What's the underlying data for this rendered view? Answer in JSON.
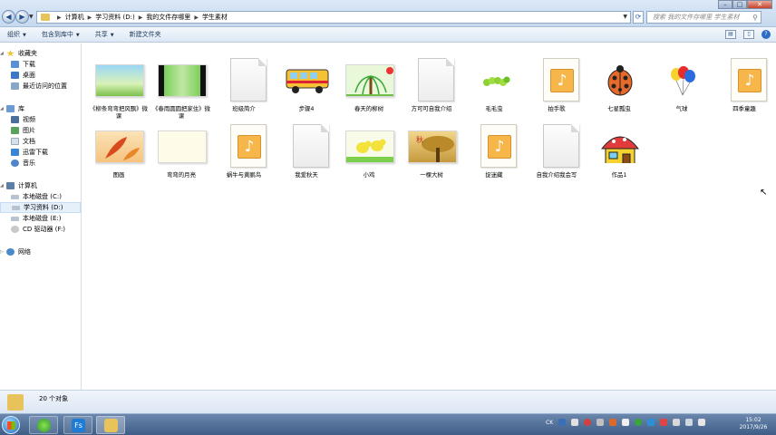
{
  "address": {
    "crumbs": [
      "计算机",
      "学习资料 (D:)",
      "我的文件存哪里",
      "学生素材"
    ],
    "search_placeholder": "搜索 我的文件存哪里 学生素材"
  },
  "toolbar": {
    "organize": "组织",
    "include": "包含到库中",
    "share": "共享",
    "new_folder": "新建文件夹"
  },
  "nav": {
    "favorites": "收藏夹",
    "downloads": "下载",
    "desktop": "桌面",
    "recent": "最近访问的位置",
    "libraries": "库",
    "videos": "视频",
    "pictures": "图片",
    "documents": "文档",
    "thunder": "迅雷下载",
    "music": "音乐",
    "computer": "计算机",
    "drive_c": "本地磁盘 (C:)",
    "drive_d": "学习资料 (D:)",
    "drive_e": "本地磁盘 (E:)",
    "drive_f": "CD 驱动器 (F:)",
    "network": "网络"
  },
  "files": [
    {
      "label": "《柳条弯弯把风飘》微课",
      "kind": "video-green"
    },
    {
      "label": "《春雨圆圆把家住》微课",
      "kind": "video-dark"
    },
    {
      "label": "班级简介",
      "kind": "doc"
    },
    {
      "label": "步骤4",
      "kind": "bus"
    },
    {
      "label": "春天的柳树",
      "kind": "willow"
    },
    {
      "label": "方可可自我介绍",
      "kind": "doc"
    },
    {
      "label": "毛毛虫",
      "kind": "caterpillar"
    },
    {
      "label": "拍手歌",
      "kind": "mp3"
    },
    {
      "label": "七星瓢虫",
      "kind": "ladybug"
    },
    {
      "label": "气球",
      "kind": "balloon"
    },
    {
      "label": "四季童趣",
      "kind": "mp3"
    },
    {
      "label": "图画",
      "kind": "autumn"
    },
    {
      "label": "弯弯的月亮",
      "kind": "moon"
    },
    {
      "label": "蜗牛与黄鹂鸟",
      "kind": "mp3"
    },
    {
      "label": "我爱秋天",
      "kind": "doc"
    },
    {
      "label": "小鸡",
      "kind": "chicks"
    },
    {
      "label": "一棵大树",
      "kind": "tree"
    },
    {
      "label": "捉迷藏",
      "kind": "mp3"
    },
    {
      "label": "自我介绍我会写",
      "kind": "doc"
    },
    {
      "label": "作品1",
      "kind": "house"
    }
  ],
  "autumn_char": "秋",
  "status": {
    "count": "20 个对象"
  },
  "taskbar": {
    "fs_label": "Fs",
    "ime": "CK",
    "time": "15:02",
    "date": "2017/9/26"
  },
  "colors": {
    "accent": "#2c6cc4",
    "folder": "#e8c25a",
    "mp3": "#f6b64a"
  }
}
